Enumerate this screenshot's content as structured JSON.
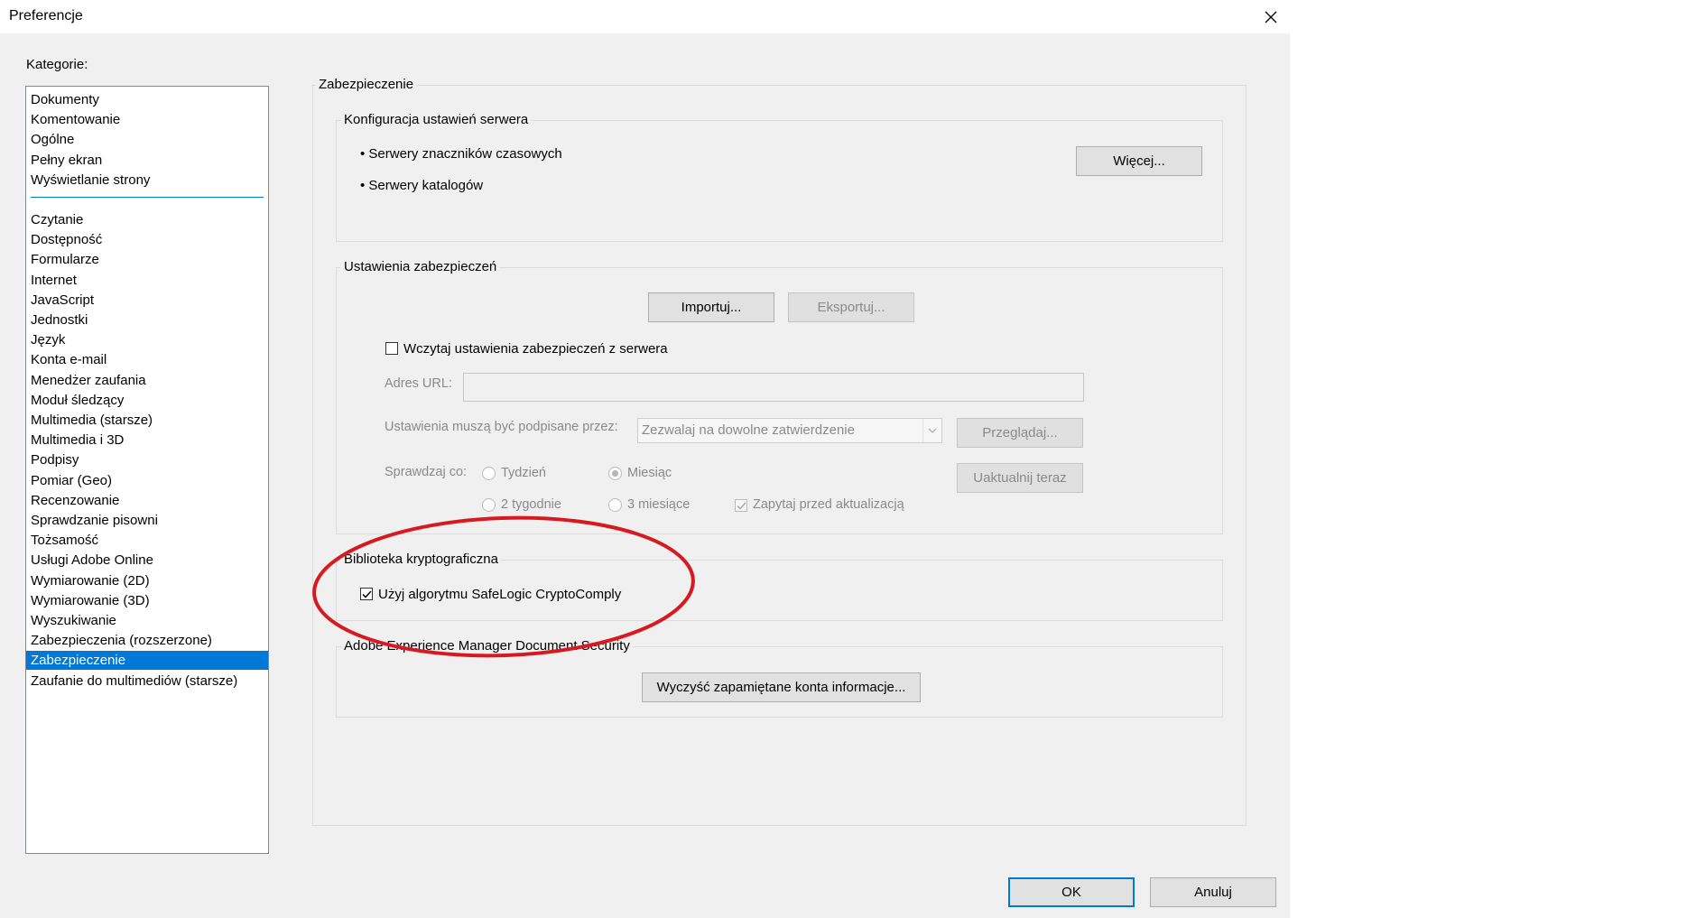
{
  "window": {
    "title": "Preferencje"
  },
  "categories": {
    "label": "Kategorie:",
    "items": [
      "Dokumenty",
      "Komentowanie",
      "Ogólne",
      "Pełny ekran",
      "Wyświetlanie strony",
      "Czytanie",
      "Dostępność",
      "Formularze",
      "Internet",
      "JavaScript",
      "Jednostki",
      "Język",
      "Konta e-mail",
      "Menedżer zaufania",
      "Moduł śledzący",
      "Multimedia (starsze)",
      "Multimedia i 3D",
      "Podpisy",
      "Pomiar (Geo)",
      "Recenzowanie",
      "Sprawdzanie pisowni",
      "Tożsamość",
      "Usługi Adobe Online",
      "Wymiarowanie (2D)",
      "Wymiarowanie (3D)",
      "Wyszukiwanie",
      "Zabezpieczenia (rozszerzone)",
      "Zabezpieczenie",
      "Zaufanie do multimediów (starsze)"
    ],
    "selected": "Zabezpieczenie"
  },
  "panel": {
    "title": "Zabezpieczenie",
    "server_config": {
      "title": "Konfiguracja ustawień serwera",
      "item1": "• Serwery znaczników czasowych",
      "item2": "• Serwery katalogów",
      "more_button": "Więcej..."
    },
    "security_settings": {
      "title": "Ustawienia zabezpieczeń",
      "import_button": "Importuj...",
      "export_button": "Eksportuj...",
      "load_from_server_label": "Wczytaj ustawienia zabezpieczeń z serwera",
      "load_from_server_checked": false,
      "url_label": "Adres URL:",
      "url_value": "",
      "signed_by_label": "Ustawienia muszą być podpisane przez:",
      "signed_by_value": "Zezwalaj na dowolne zatwierdzenie",
      "browse_button": "Przeglądaj...",
      "check_label": "Sprawdzaj co:",
      "opt_week": "Tydzień",
      "opt_month": "Miesiąc",
      "opt_2weeks": "2 tygodnie",
      "opt_3months": "3 miesiące",
      "selected_interval": "Miesiąc",
      "ask_before_update": "Zapytaj przed aktualizacją",
      "ask_before_update_checked": true,
      "update_now_button": "Uaktualnij teraz"
    },
    "crypto": {
      "title": "Biblioteka kryptograficzna",
      "use_safelogic": "Użyj algorytmu SafeLogic CryptoComply",
      "use_safelogic_checked": true
    },
    "aem": {
      "title": "Adobe Experience Manager Document Security",
      "clear_button": "Wyczyść zapamiętane konta informacje..."
    }
  },
  "footer": {
    "ok_button": "OK",
    "cancel_button": "Anuluj"
  },
  "colors": {
    "selection": "#0078d7",
    "highlight_ellipse": "#d71920"
  }
}
